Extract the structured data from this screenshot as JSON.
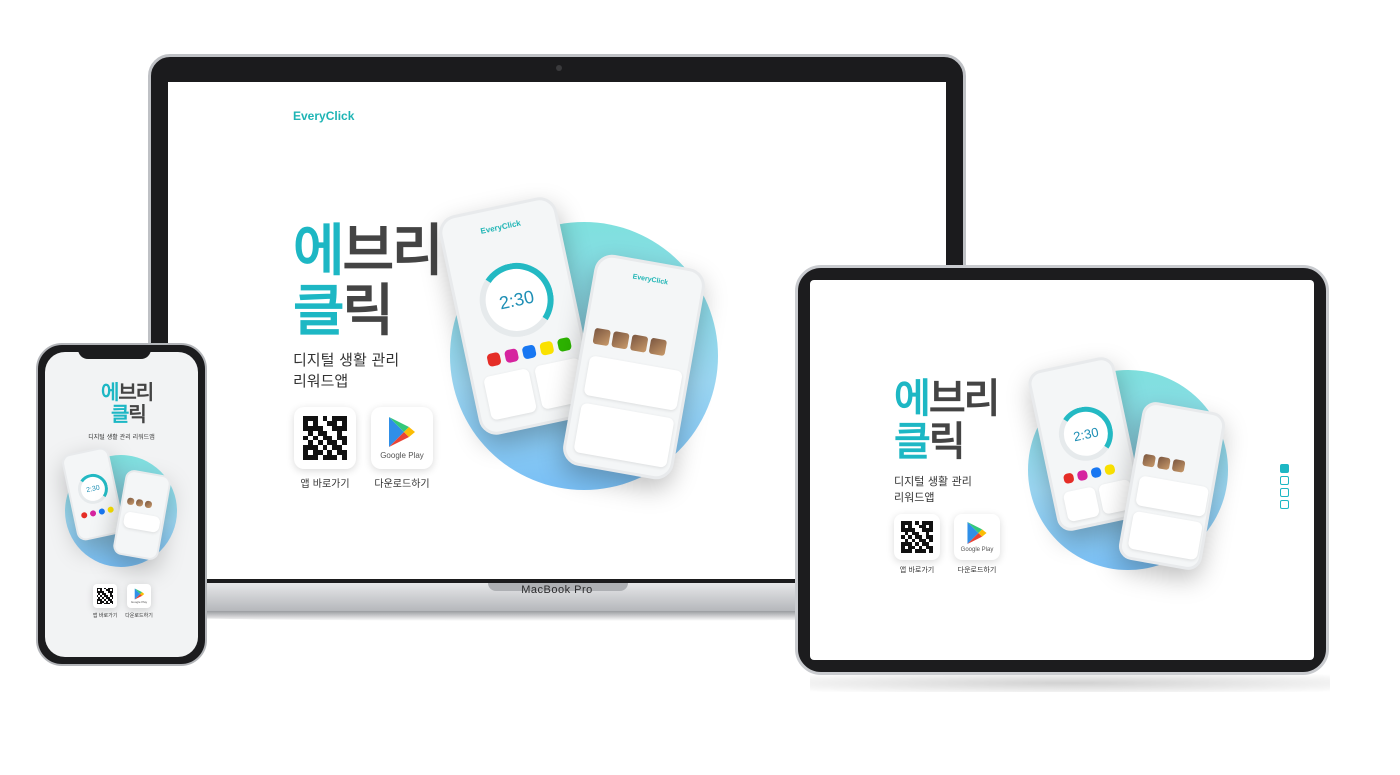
{
  "brand": {
    "logo": "EveryClick",
    "accent_color": "#1db7c4",
    "gradient_from": "#7fe0de",
    "gradient_to": "#79bff5"
  },
  "hero": {
    "title_line1_accent": "에",
    "title_line1_rest": "브리",
    "title_line2_accent": "클",
    "title_line2_rest": "릭",
    "subtitle_line1": "디지털 생활 관리",
    "subtitle_line2": "리워드앱",
    "subtitle_single": "디지털 생활 관리 리워드앱"
  },
  "downloads": {
    "qr_label": "앱 바로가기",
    "gp_label": "다운로드하기",
    "gp_badge_text": "Google Play"
  },
  "mockup": {
    "timer": "2:30",
    "mini_logo": "EveryClick"
  },
  "laptop": {
    "model_label": "MacBook Pro"
  }
}
